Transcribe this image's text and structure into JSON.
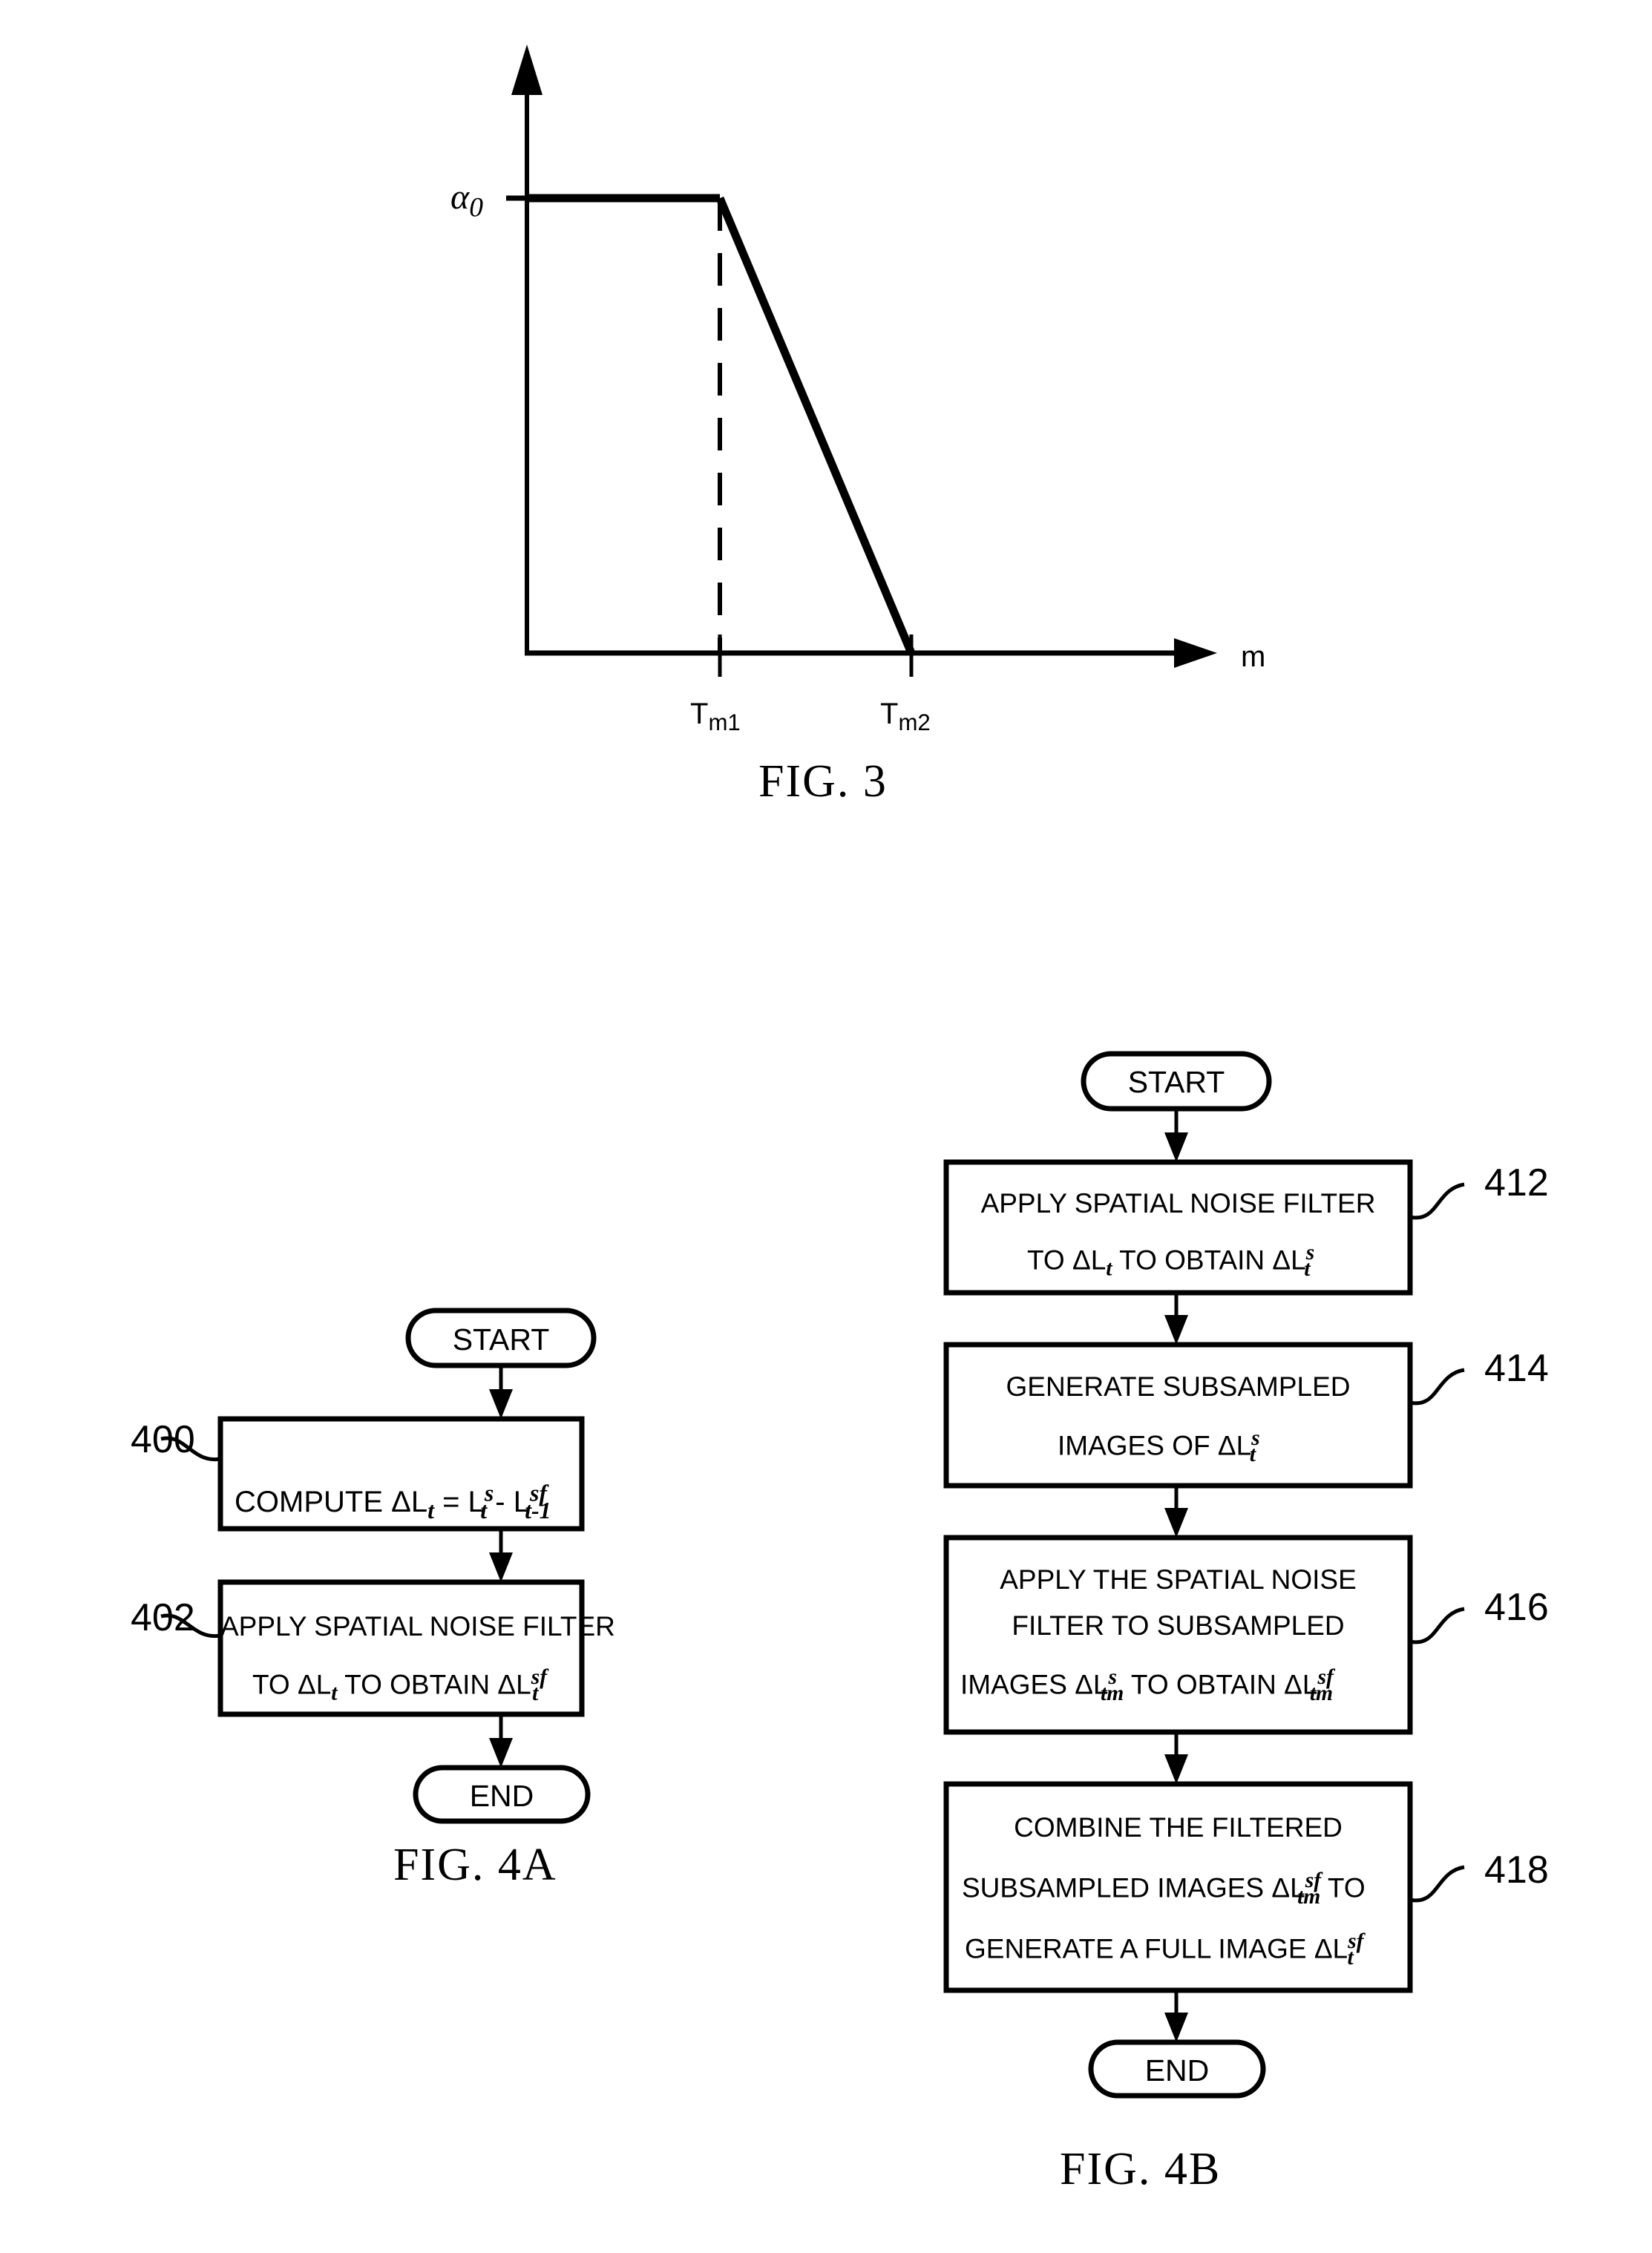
{
  "document": {
    "type": "patent-drawing-sheet",
    "background": "#ffffff",
    "ink": "#000000"
  },
  "fig3": {
    "caption": "FIG. 3",
    "y_axis_label": "α",
    "y_axis_label_sub": "0",
    "x_axis_label": "m",
    "ticks": [
      {
        "label_main": "T",
        "label_sub": "m1"
      },
      {
        "label_main": "T",
        "label_sub": "m2"
      }
    ],
    "description": "Piecewise-linear weighting curve: constant at alpha-0 until Tm1, then linearly decreasing to zero at Tm2"
  },
  "chart_data": {
    "type": "line",
    "title": "FIG. 3",
    "xlabel": "m",
    "ylabel": "α₀",
    "xlim": [
      0,
      1
    ],
    "ylim": [
      0,
      1
    ],
    "grid": false,
    "legend": null,
    "xticks": [
      "Tₘ₁",
      "Tₘ₂"
    ],
    "xtick_values": [
      0.43,
      0.7
    ],
    "yticks": [
      "α₀"
    ],
    "ytick_values": [
      1.0
    ],
    "series": [
      {
        "name": "alpha(m)",
        "x": [
          0.0,
          0.43,
          0.7
        ],
        "y": [
          1.0,
          1.0,
          0.0
        ]
      }
    ],
    "annotations": [
      {
        "type": "dashed-vline",
        "x": 0.43,
        "from_y": 0.0,
        "to_y": 1.0
      }
    ]
  },
  "fig4a": {
    "caption": "FIG. 4A",
    "start_label": "START",
    "end_label": "END",
    "steps": [
      {
        "ref": "400",
        "lines": [
          {
            "parts": [
              {
                "t": "COMPUTE ΔL",
                "k": "base"
              },
              {
                "t": "t",
                "k": "sub"
              },
              {
                "t": " = L",
                "k": "base"
              },
              {
                "t": "s",
                "k": "sup"
              },
              {
                "t": "t",
                "k": "sub"
              },
              {
                "t": " - L",
                "k": "base"
              },
              {
                "t": "sf",
                "k": "sup"
              },
              {
                "t": "t-1",
                "k": "sub"
              }
            ]
          }
        ],
        "plain": "COMPUTE ΔLt = Lts - Lt-1sf"
      },
      {
        "ref": "402",
        "lines": [
          {
            "parts": [
              {
                "t": "APPLY SPATIAL NOISE FILTER",
                "k": "base"
              }
            ]
          },
          {
            "parts": [
              {
                "t": "TO ΔL",
                "k": "base"
              },
              {
                "t": "t",
                "k": "sub"
              },
              {
                "t": " TO OBTAIN ΔL",
                "k": "base"
              },
              {
                "t": "sf",
                "k": "sup"
              },
              {
                "t": "t",
                "k": "sub"
              }
            ]
          }
        ],
        "plain": "APPLY SPATIAL NOISE FILTER TO ΔLt TO OBTAIN ΔLtsf"
      }
    ]
  },
  "fig4b": {
    "caption": "FIG. 4B",
    "start_label": "START",
    "end_label": "END",
    "steps": [
      {
        "ref": "412",
        "lines": [
          {
            "parts": [
              {
                "t": "APPLY SPATIAL NOISE FILTER",
                "k": "base"
              }
            ]
          },
          {
            "parts": [
              {
                "t": "TO ΔL",
                "k": "base"
              },
              {
                "t": "t",
                "k": "sub"
              },
              {
                "t": " TO OBTAIN ΔL",
                "k": "base"
              },
              {
                "t": "s",
                "k": "sup"
              },
              {
                "t": "t",
                "k": "sub"
              }
            ]
          }
        ],
        "plain": "APPLY SPATIAL NOISE FILTER TO ΔLt TO OBTAIN ΔLts"
      },
      {
        "ref": "414",
        "lines": [
          {
            "parts": [
              {
                "t": "GENERATE SUBSAMPLED",
                "k": "base"
              }
            ]
          },
          {
            "parts": [
              {
                "t": "IMAGES OF ΔL",
                "k": "base"
              },
              {
                "t": "s",
                "k": "sup"
              },
              {
                "t": "t",
                "k": "sub"
              }
            ]
          }
        ],
        "plain": "GENERATE SUBSAMPLED IMAGES OF ΔLts"
      },
      {
        "ref": "416",
        "lines": [
          {
            "parts": [
              {
                "t": "APPLY THE SPATIAL NOISE",
                "k": "base"
              }
            ]
          },
          {
            "parts": [
              {
                "t": "FILTER TO SUBSAMPLED",
                "k": "base"
              }
            ]
          },
          {
            "parts": [
              {
                "t": "IMAGES ΔL",
                "k": "base"
              },
              {
                "t": "s",
                "k": "sup"
              },
              {
                "t": "tm",
                "k": "sub"
              },
              {
                "t": " TO OBTAIN ΔL",
                "k": "base"
              },
              {
                "t": "sf",
                "k": "sup"
              },
              {
                "t": "tm",
                "k": "sub"
              }
            ]
          }
        ],
        "plain": "APPLY THE SPATIAL NOISE FILTER TO SUBSAMPLED IMAGES ΔLtms TO OBTAIN ΔLtmsf"
      },
      {
        "ref": "418",
        "lines": [
          {
            "parts": [
              {
                "t": "COMBINE THE FILTERED",
                "k": "base"
              }
            ]
          },
          {
            "parts": [
              {
                "t": "SUBSAMPLED IMAGES ΔL",
                "k": "base"
              },
              {
                "t": "sf",
                "k": "sup"
              },
              {
                "t": "tm",
                "k": "sub"
              },
              {
                "t": " TO",
                "k": "base"
              }
            ]
          },
          {
            "parts": [
              {
                "t": "GENERATE A FULL IMAGE ΔL",
                "k": "base"
              },
              {
                "t": "sf",
                "k": "sup"
              },
              {
                "t": "t",
                "k": "sub"
              }
            ]
          }
        ],
        "plain": "COMBINE THE FILTERED SUBSAMPLED IMAGES ΔLtmsf TO GENERATE A FULL IMAGE ΔLtsf"
      }
    ]
  }
}
